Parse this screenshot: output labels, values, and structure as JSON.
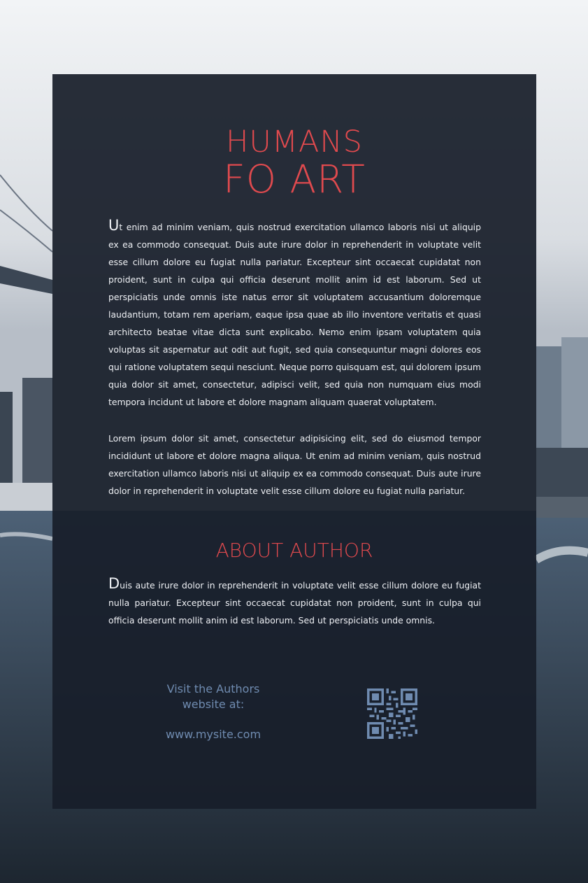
{
  "header": {
    "title_line1": "HUMANS",
    "title_line2": "FO ART"
  },
  "intro": {
    "p1_dropcap": "U",
    "p1_text": "t enim ad minim veniam, quis nostrud exercitation ullamco laboris nisi ut aliquip ex ea commodo consequat. Duis aute irure dolor in reprehenderit in voluptate velit esse cillum dolore eu fugiat nulla pariatur. Excepteur sint occaecat cupidatat non proident, sunt in culpa qui officia deserunt mollit anim id est laborum. Sed ut perspiciatis unde omnis iste natus error sit voluptatem accusantium doloremque laudantium, totam rem aperiam, eaque ipsa quae ab illo inventore veritatis et quasi architecto beatae vitae dicta sunt explicabo. Nemo enim ipsam voluptatem quia voluptas sit aspernatur aut odit aut fugit, sed quia consequuntur magni dolores eos qui ratione voluptatem sequi nesciunt. Neque porro quisquam est, qui dolorem ipsum quia dolor sit amet, consectetur, adipisci velit, sed quia non numquam eius modi tempora incidunt ut labore et dolore magnam aliquam quaerat voluptatem.",
    "p2_text": "Lorem ipsum dolor sit amet, consectetur adipisicing elit, sed do eiusmod tempor incididunt ut labore et dolore magna aliqua. Ut enim ad minim veniam, quis nostrud exercitation ullamco laboris nisi ut aliquip ex ea commodo consequat. Duis aute irure dolor in reprehenderit in voluptate velit esse cillum dolore eu fugiat nulla pariatur."
  },
  "about": {
    "heading": "ABOUT AUTHOR",
    "dropcap": "D",
    "text": "uis aute irure dolor in reprehenderit in voluptate velit esse cillum dolore eu fugiat nulla pariatur. Excepteur sint occaecat cupidatat non proident, sunt in culpa qui officia deserunt mollit anim id est laborum. Sed ut perspiciatis unde omnis."
  },
  "footer": {
    "visit_line1": "Visit the Authors",
    "visit_line2": "website at:",
    "website": "www.mysite.com",
    "qr_icon": "qr-code-icon"
  },
  "colors": {
    "accent": "#e04a4e",
    "link": "#6f8bb0",
    "panel": "#181e2a"
  }
}
